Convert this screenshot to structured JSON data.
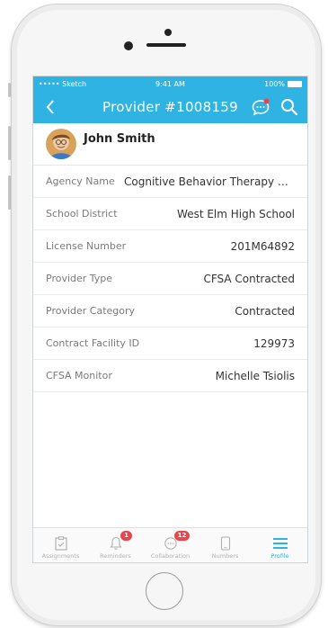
{
  "status_bar": {
    "carrier": "••••• Sketch",
    "time": "9:41 AM",
    "battery": "100%"
  },
  "nav": {
    "title": "Provider #1008159"
  },
  "profile": {
    "name": "John Smith"
  },
  "details": [
    {
      "label": "Agency Name",
      "value": "Cognitive Behavior Therapy C..."
    },
    {
      "label": "School District",
      "value": "West Elm High School"
    },
    {
      "label": "License Number",
      "value": "201M64892"
    },
    {
      "label": "Provider Type",
      "value": "CFSA Contracted"
    },
    {
      "label": "Provider Category",
      "value": "Contracted"
    },
    {
      "label": "Contract Facility ID",
      "value": "129973"
    },
    {
      "label": "CFSA Monitor",
      "value": "Michelle Tsiolis"
    }
  ],
  "tabs": [
    {
      "label": "Assignments",
      "icon": "clipboard-icon"
    },
    {
      "label": "Reminders",
      "icon": "bell-icon",
      "badge": "1"
    },
    {
      "label": "Collaboration",
      "icon": "chat-bubble-icon",
      "badge": "12"
    },
    {
      "label": "Numbers",
      "icon": "phone-device-icon"
    },
    {
      "label": "Profile",
      "icon": "menu-icon",
      "active": true
    }
  ],
  "colors": {
    "accent": "#2eb3e3",
    "badge": "#e8454f"
  }
}
